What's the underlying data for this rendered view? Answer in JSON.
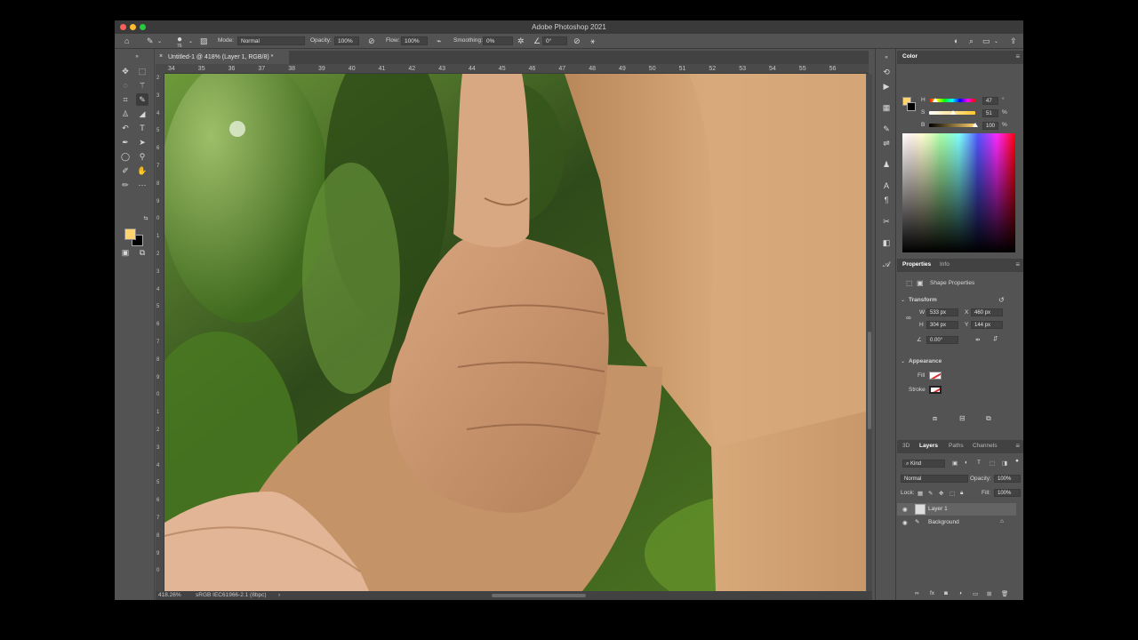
{
  "window": {
    "title": "Adobe Photoshop 2021"
  },
  "options_bar": {
    "brush_size": "76",
    "mode_label": "Mode:",
    "mode_value": "Normal",
    "opacity_label": "Opacity:",
    "opacity_value": "100%",
    "flow_label": "Flow:",
    "flow_value": "100%",
    "smoothing_label": "Smoothing:",
    "smoothing_value": "0%",
    "angle_value": "0°"
  },
  "document": {
    "tab_title": "Untitled-1 @ 418% (Layer 1, RGB/8) *",
    "ruler_top": [
      "34",
      "35",
      "36",
      "37",
      "38",
      "39",
      "40",
      "41",
      "42",
      "43",
      "44",
      "45",
      "46",
      "47",
      "48",
      "49",
      "50",
      "51",
      "52",
      "53",
      "54",
      "55",
      "56"
    ],
    "ruler_left": [
      "2",
      "3",
      "4",
      "5",
      "6",
      "7",
      "8",
      "9",
      "0",
      "1",
      "2",
      "3",
      "4",
      "5",
      "6",
      "7",
      "8",
      "9",
      "0",
      "1",
      "2",
      "3",
      "4",
      "5",
      "6",
      "7",
      "8",
      "9",
      "0"
    ]
  },
  "status": {
    "zoom": "418.26%",
    "profile": "sRGB IEC61966-2.1 (8bpc)",
    "arrow": "›"
  },
  "color_panel": {
    "tab": "Color",
    "h_label": "H",
    "h_value": "47",
    "h_unit": "°",
    "s_label": "S",
    "s_value": "51",
    "s_unit": "%",
    "b_label": "B",
    "b_value": "100",
    "b_unit": "%",
    "h_level": 0.13,
    "s_level": 0.51,
    "b_level": 1.0
  },
  "properties_panel": {
    "tabs": [
      "Properties",
      "Info"
    ],
    "kind": "Shape Properties",
    "transform_label": "Transform",
    "w_label": "W",
    "w_value": "533 px",
    "x_label": "X",
    "x_value": "460 px",
    "h_label": "H",
    "h_value": "304 px",
    "y_label": "Y",
    "y_value": "144 px",
    "angle_value": "0.00°",
    "appearance_label": "Appearance",
    "fill_label": "Fill",
    "stroke_label": "Stroke"
  },
  "layers_panel": {
    "tabs": [
      "3D",
      "Layers",
      "Paths",
      "Channels"
    ],
    "filter_label": "Kind",
    "blend_mode": "Normal",
    "opacity_label": "Opacity:",
    "opacity_value": "100%",
    "lock_label": "Lock:",
    "fill_label": "Fill:",
    "fill_value": "100%",
    "layers": [
      {
        "name": "Layer 1"
      },
      {
        "name": "Background"
      }
    ]
  },
  "colors": {
    "foreground": "#ffd36d",
    "background": "#000000",
    "app_bg": "#535353",
    "panel_dark": "#424242"
  }
}
